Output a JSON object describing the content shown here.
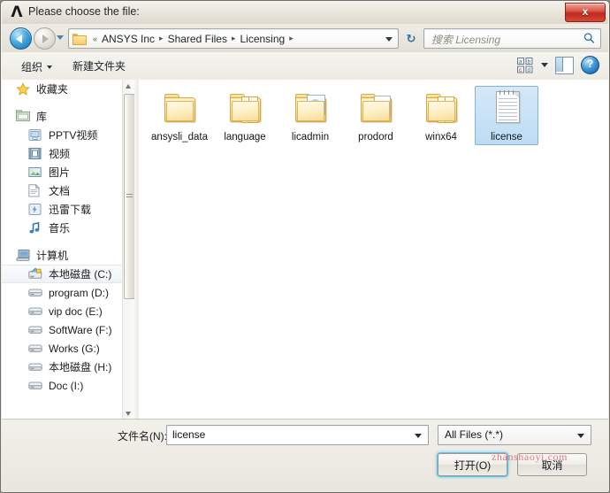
{
  "window": {
    "title": "Please choose the file:",
    "app_icon": "ansys-lambda-icon",
    "close_label": "x"
  },
  "navbar": {
    "back_icon": "back-arrow-icon",
    "forward_icon": "forward-arrow-icon",
    "recent_icon": "recent-locations-chevron-icon",
    "folder_icon": "folder-icon",
    "breadcrumb_prefix": "«",
    "breadcrumbs": [
      "ANSYS Inc",
      "Shared Files",
      "Licensing"
    ],
    "separator": "▸",
    "dropdown_icon": "chevron-down-icon",
    "refresh_label": "↻",
    "refresh_icon": "refresh-icon",
    "search_placeholder": "搜索 Licensing",
    "search_icon": "search-icon"
  },
  "toolbar": {
    "organize_label": "组织",
    "new_folder_label": "新建文件夹",
    "view_mode_icon": "view-mode-icon",
    "view_mode_arrow_icon": "chevron-down-icon",
    "preview_pane_icon": "preview-pane-icon",
    "help_label": "?",
    "help_icon": "help-icon"
  },
  "sidebar": {
    "groups": [
      {
        "header": {
          "label": "收藏夹",
          "icon": "star-icon"
        },
        "items": []
      },
      {
        "header": {
          "label": "库",
          "icon": "library-icon"
        },
        "items": [
          {
            "label": "PPTV视频",
            "icon": "pptv-video-icon"
          },
          {
            "label": "视频",
            "icon": "video-icon"
          },
          {
            "label": "图片",
            "icon": "pictures-icon"
          },
          {
            "label": "文档",
            "icon": "documents-icon"
          },
          {
            "label": "迅雷下载",
            "icon": "thunder-download-icon"
          },
          {
            "label": "音乐",
            "icon": "music-note-icon"
          }
        ]
      },
      {
        "header": {
          "label": "计算机",
          "icon": "computer-icon"
        },
        "items": [
          {
            "label": "本地磁盘 (C:)",
            "icon": "system-drive-icon",
            "selected": true
          },
          {
            "label": "program (D:)",
            "icon": "drive-icon"
          },
          {
            "label": "vip doc (E:)",
            "icon": "drive-icon"
          },
          {
            "label": "SoftWare (F:)",
            "icon": "drive-icon"
          },
          {
            "label": "Works (G:)",
            "icon": "drive-icon"
          },
          {
            "label": "本地磁盘 (H:)",
            "icon": "drive-icon"
          },
          {
            "label": "Doc (I:)",
            "icon": "drive-icon"
          }
        ]
      }
    ],
    "scrollbar": {
      "up_icon": "scroll-up-arrow-icon",
      "down_icon": "scroll-down-arrow-icon"
    }
  },
  "files": [
    {
      "name": "ansysli_data",
      "kind": "folder",
      "icon": "folder-icon",
      "selected": false
    },
    {
      "name": "language",
      "kind": "folder-multi",
      "icon": "folder-icon",
      "selected": false
    },
    {
      "name": "licadmin",
      "kind": "folder-gear",
      "icon": "folder-icon",
      "selected": false
    },
    {
      "name": "prodord",
      "kind": "folder-doc",
      "icon": "folder-icon",
      "selected": false
    },
    {
      "name": "winx64",
      "kind": "folder-multi",
      "icon": "folder-icon",
      "selected": false
    },
    {
      "name": "license",
      "kind": "textfile",
      "icon": "text-file-icon",
      "selected": true
    }
  ],
  "footer": {
    "filename_label": "文件名(N):",
    "filename_value": "license",
    "filename_placeholder": "",
    "filename_arrow_icon": "chevron-down-icon",
    "filter_value": "All Files (*.*)",
    "filter_arrow_icon": "chevron-down-icon",
    "open_label": "打开(O)",
    "cancel_label": "取消"
  },
  "watermark": "zhanshaoyi.com",
  "colors": {
    "selection": "#bcdcf4",
    "selection_border": "#7fb4dd",
    "close_button": "#bd2a1c",
    "focus_glow": "#5ec2ee",
    "watermark": "#e4757f"
  }
}
